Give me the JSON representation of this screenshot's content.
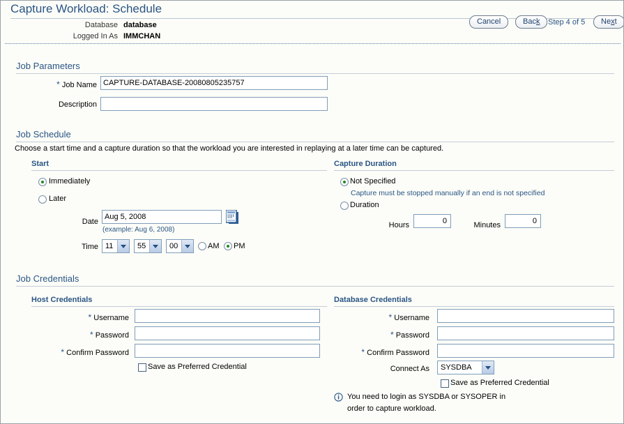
{
  "header": {
    "title": "Capture Workload: Schedule",
    "database_label": "Database",
    "database_value": "database",
    "logged_in_label": "Logged In As",
    "logged_in_value": "IMMCHAN",
    "cancel_label": "Cancel",
    "back_label": "Back",
    "step_text": "Step 4 of 5",
    "next_label": "Next"
  },
  "job_parameters": {
    "heading": "Job Parameters",
    "job_name_label": "Job Name",
    "job_name_value": "CAPTURE-DATABASE-20080805235757",
    "description_label": "Description",
    "description_value": ""
  },
  "job_schedule": {
    "heading": "Job Schedule",
    "intro": "Choose a start time and a capture duration so that the workload you are interested in replaying at a later time can be captured.",
    "start": {
      "heading": "Start",
      "immediately_label": "Immediately",
      "immediately_selected": true,
      "later_label": "Later",
      "later_selected": false,
      "date_label": "Date",
      "date_value": "Aug 5, 2008",
      "date_hint": "(example: Aug 6, 2008)",
      "calendar_icon": "calendar-icon",
      "time_label": "Time",
      "time_hour": "11",
      "time_minute": "55",
      "time_second": "00",
      "am_label": "AM",
      "pm_label": "PM",
      "am_selected": false,
      "pm_selected": true
    },
    "duration": {
      "heading": "Capture Duration",
      "not_specified_label": "Not Specified",
      "not_specified_selected": true,
      "not_specified_note": "Capture must be stopped manually if an end is not specified",
      "duration_label": "Duration",
      "duration_selected": false,
      "hours_label": "Hours",
      "hours_value": "0",
      "minutes_label": "Minutes",
      "minutes_value": "0"
    }
  },
  "job_credentials": {
    "heading": "Job Credentials",
    "host": {
      "heading": "Host Credentials",
      "username_label": "Username",
      "username_value": "",
      "password_label": "Password",
      "password_value": "",
      "confirm_label": "Confirm Password",
      "confirm_value": "",
      "save_label": "Save as Preferred Credential",
      "save_checked": false
    },
    "database": {
      "heading": "Database Credentials",
      "username_label": "Username",
      "username_value": "",
      "password_label": "Password",
      "password_value": "",
      "confirm_label": "Confirm Password",
      "confirm_value": "",
      "connect_as_label": "Connect As",
      "connect_as_value": "SYSDBA",
      "save_label": "Save as Preferred Credential",
      "save_checked": false,
      "info_icon": "info-icon",
      "info_text": "You need to login as SYSDBA or SYSOPER in order to capture workload."
    }
  },
  "colors": {
    "accent_blue": "#2a5584",
    "page_bg": "#fcfdf8",
    "field_border": "#7f9db9",
    "radio_dot": "#1e8a1e"
  }
}
